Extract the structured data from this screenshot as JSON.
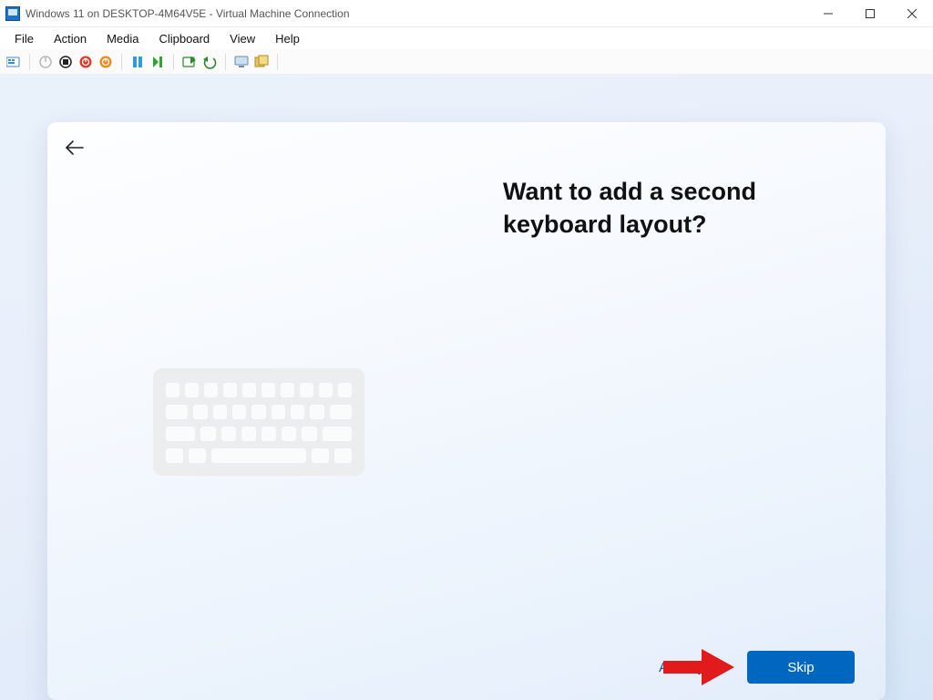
{
  "window": {
    "title": "Windows 11 on DESKTOP-4M64V5E - Virtual Machine Connection"
  },
  "menu": {
    "file": "File",
    "action": "Action",
    "media": "Media",
    "clipboard": "Clipboard",
    "view": "View",
    "help": "Help"
  },
  "oobe": {
    "heading": "Want to add a second keyboard layout?",
    "add_layout": "Add layout",
    "skip": "Skip"
  }
}
